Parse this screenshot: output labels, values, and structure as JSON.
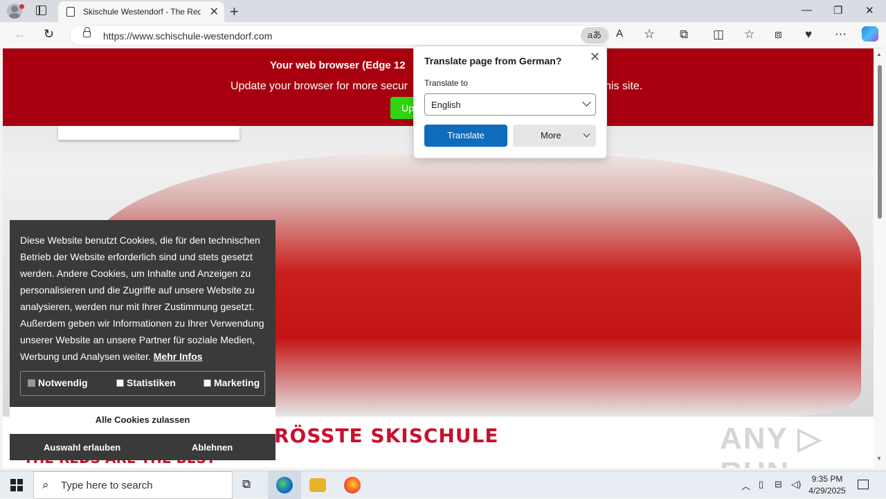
{
  "browser": {
    "tab_title": "Skischule Westendorf - The Reds",
    "tab_close": "✕",
    "new_tab": "+",
    "url": "https://www.schischule-westendorf.com",
    "translate_icon": "aあ",
    "window_controls": {
      "minimize": "—",
      "restore": "❐",
      "close": "✕"
    }
  },
  "banner": {
    "title": "Your web browser (Edge 12",
    "message_left": "Update your browser for more secur",
    "message_right": "his site.",
    "update_label": "Up",
    "color": "#a8000f"
  },
  "page": {
    "headline": "RÖSSTE SKISCHULE",
    "subline": "THE REDS ARE THE BEST",
    "watermark": "ANY ▷ RUN"
  },
  "cookie": {
    "text": "Diese Website benutzt Cookies, die für den technischen Betrieb der Website erforderlich sind und stets gesetzt werden. Andere Cookies, um Inhalte und Anzeigen zu personalisieren und die Zugriffe auf unsere Website zu analysieren, werden nur mit Ihrer Zustimmung gesetzt. Außerdem geben wir Informationen zu Ihrer Verwendung unserer Website an unsere Partner für soziale Medien, Werbung und Analysen weiter.",
    "more_info": "Mehr Infos",
    "options": [
      {
        "label": "Notwendig",
        "checked": true
      },
      {
        "label": "Statistiken",
        "checked": false
      },
      {
        "label": "Marketing",
        "checked": false
      }
    ],
    "accept_all": "Alle Cookies zulassen",
    "allow_selection": "Auswahl erlauben",
    "decline": "Ablehnen"
  },
  "translate_popup": {
    "title": "Translate page from German?",
    "translate_to_label": "Translate to",
    "language": "English",
    "translate_button": "Translate",
    "more_button": "More",
    "accent": "#0f6cbd"
  },
  "taskbar": {
    "search_placeholder": "Type here to search",
    "time": "9:35 PM",
    "date": "4/29/2025"
  }
}
